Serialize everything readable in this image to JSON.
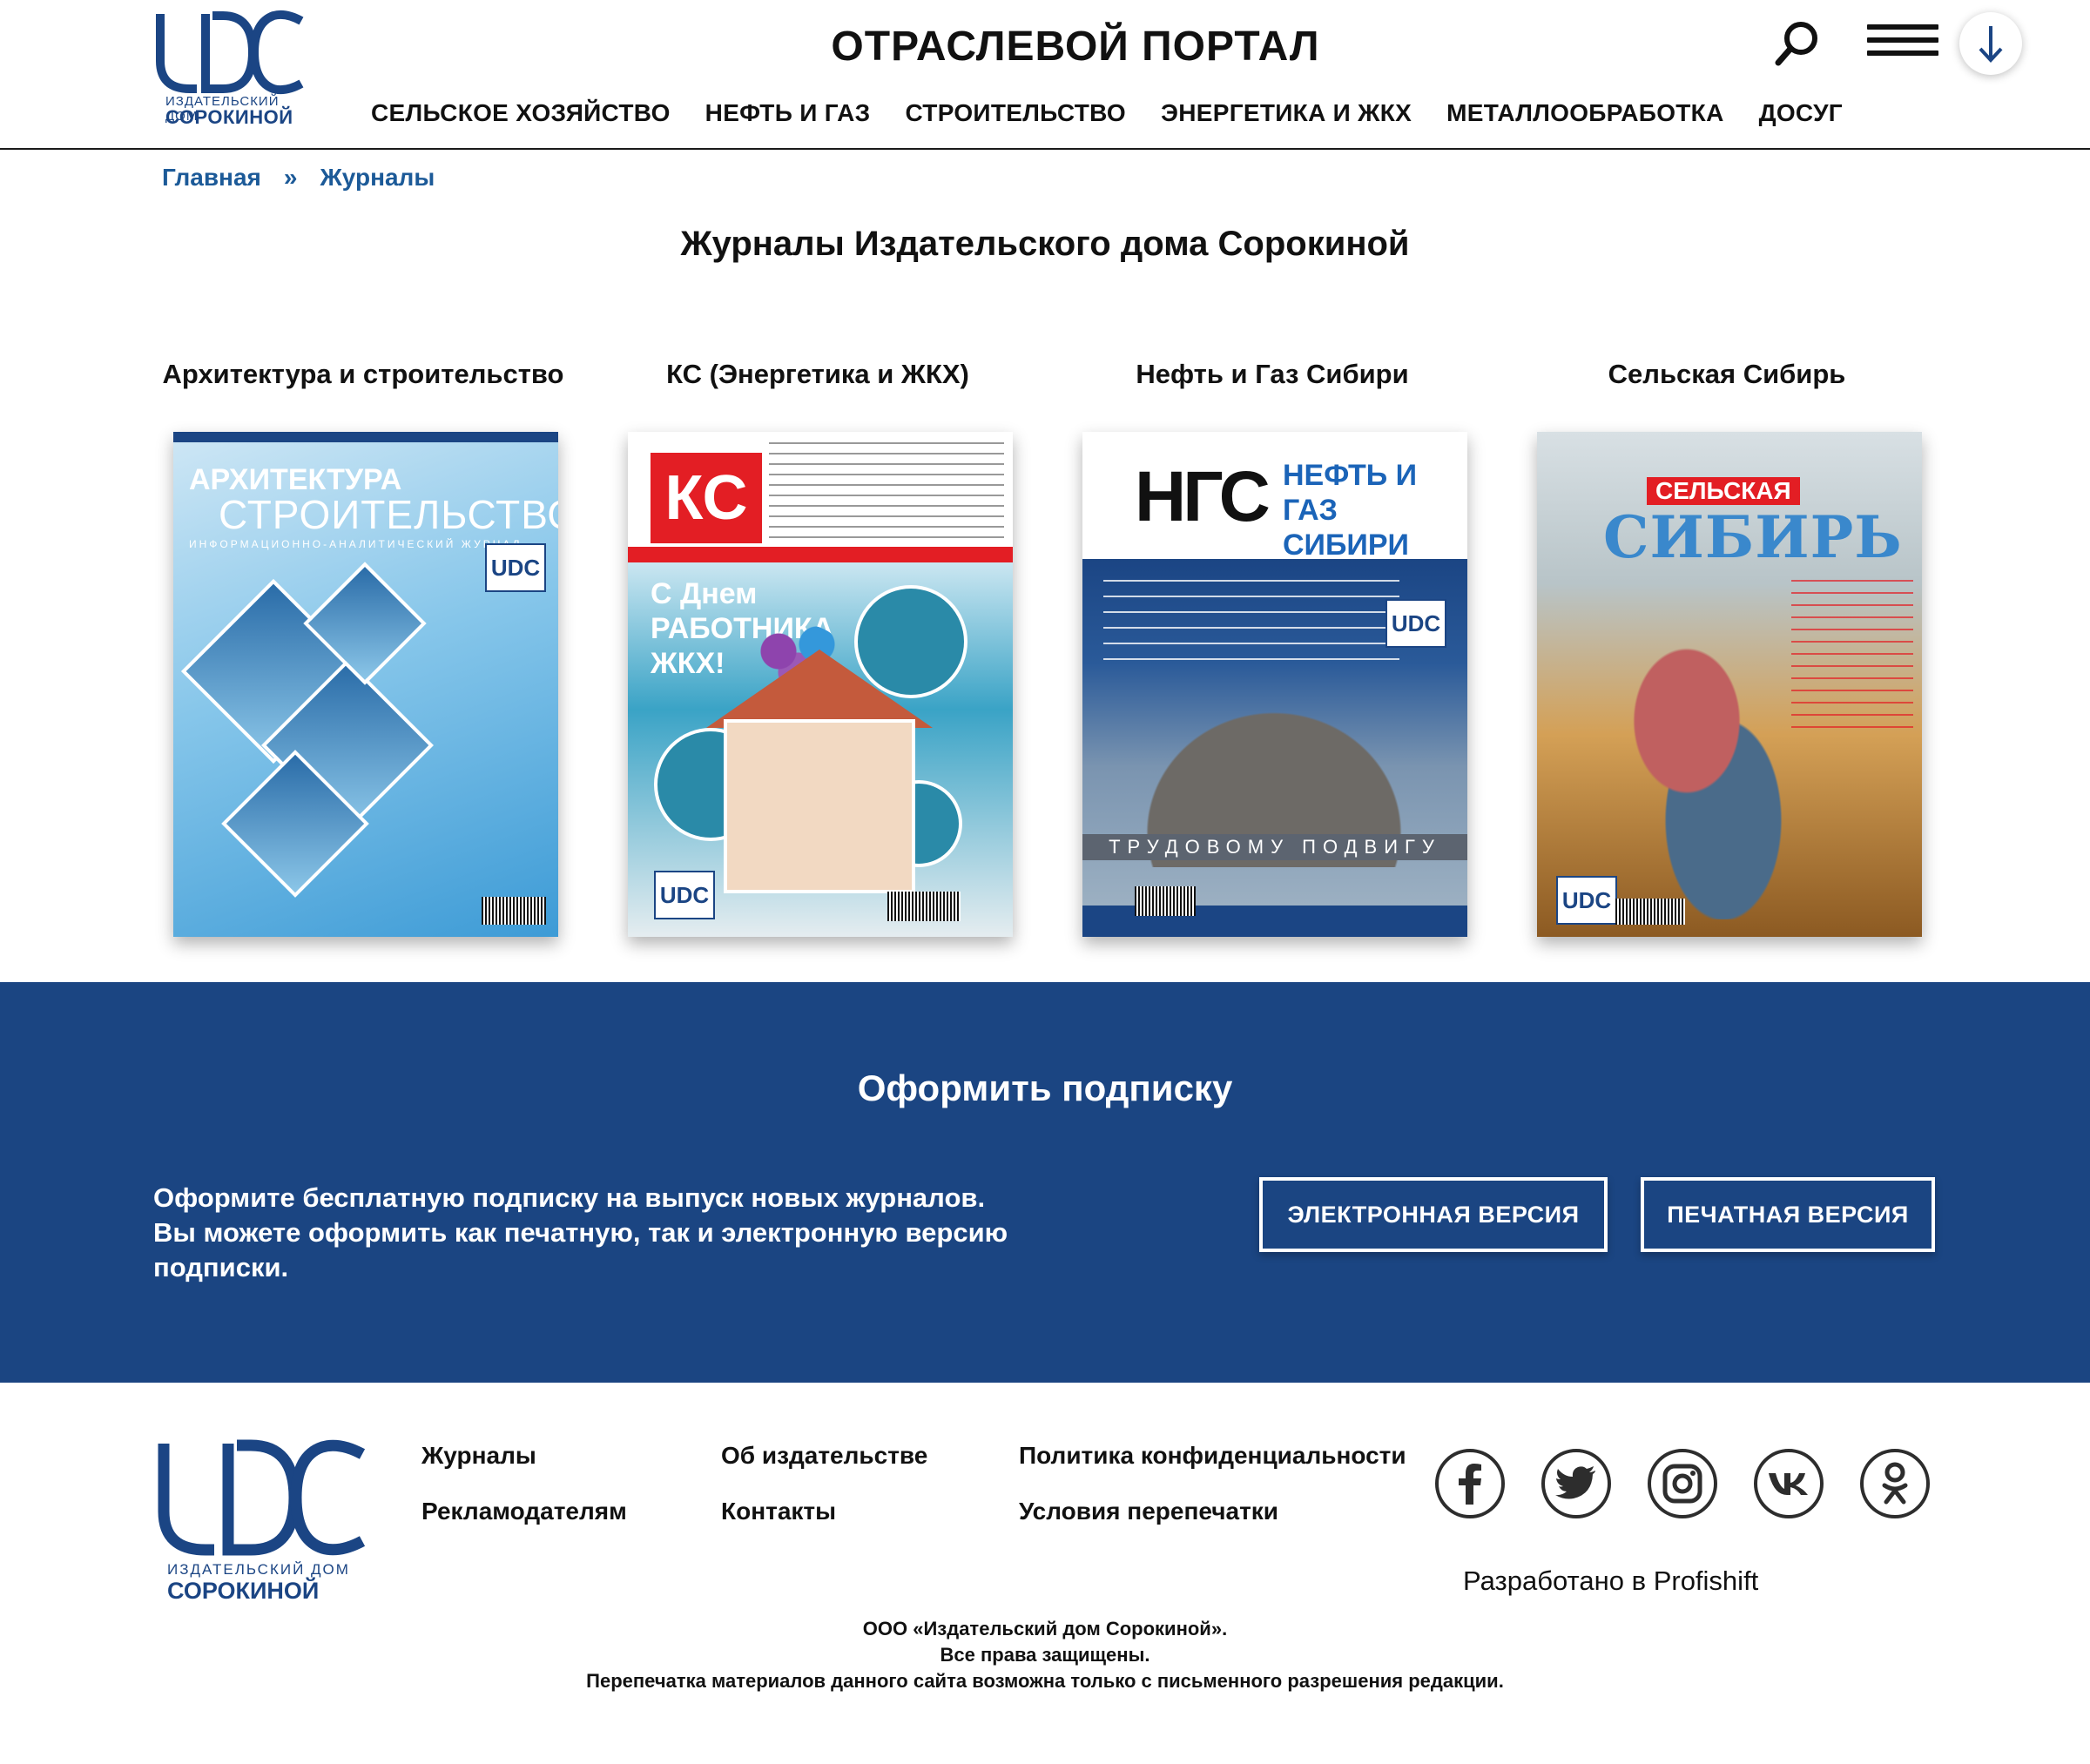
{
  "header": {
    "logo_text": "UDC",
    "logo_sub": "ИЗДАТЕЛЬСКИЙ ДОМ",
    "logo_name": "СОРОКИНОЙ",
    "portal_title": "ОТРАСЛЕВОЙ ПОРТАЛ",
    "nav": [
      "СЕЛЬСКОЕ ХОЗЯЙСТВО",
      "НЕФТЬ И ГАЗ",
      "СТРОИТЕЛЬСТВО",
      "ЭНЕРГЕТИКА И ЖКХ",
      "МЕТАЛЛООБРАБОТКА",
      "ДОСУГ"
    ],
    "icons": [
      "search-icon",
      "menu-icon",
      "arrow-down-icon"
    ]
  },
  "breadcrumb": {
    "home": "Главная",
    "separator": "»",
    "current": "Журналы"
  },
  "page_title": "Журналы Издательского дома Сорокиной",
  "magazines": [
    {
      "title": "Архитектура и строительство",
      "cover_line1": "АРХИТЕКТУРА",
      "cover_line2": "СТРОИТЕЛЬСТВО",
      "cover_line3": "ИНФОРМАЦИОННО-АНАЛИТИЧЕСКИЙ ЖУРНАЛ"
    },
    {
      "title": "КС (Энергетика и ЖКХ)",
      "cover_logo": "КС",
      "cover_line1": "С Днем",
      "cover_line2": "РАБОТНИКА",
      "cover_line3": "ЖКХ!"
    },
    {
      "title": "Нефть и Газ Сибири",
      "cover_logo": "НГС",
      "cover_line1": "НЕФТЬ И ГАЗ",
      "cover_line2": "СИБИРИ",
      "cover_line3": "ТРУДОВОМУ ПОДВИГУ"
    },
    {
      "title": "Сельская Сибирь",
      "cover_line1": "СЕЛЬСКАЯ",
      "cover_line2": "СИБИРЬ"
    }
  ],
  "subscribe": {
    "title": "Оформить подписку",
    "text": "Оформите бесплатную подписку на выпуск новых журналов. Вы можете оформить как печатную, так и электронную версию подписки.",
    "btn_electronic": "ЭЛЕКТРОННАЯ ВЕРСИЯ",
    "btn_print": "ПЕЧАТНАЯ ВЕРСИЯ",
    "bg_color": "#1b4582"
  },
  "footer": {
    "links": {
      "journals": "Журналы",
      "advertisers": "Рекламодателям",
      "about": "Об издательстве",
      "contacts": "Контакты",
      "privacy": "Политика конфиденциальности",
      "reprint": "Условия перепечатки"
    },
    "social": [
      "facebook-icon",
      "twitter-icon",
      "instagram-icon",
      "vk-icon",
      "odnoklassniki-icon"
    ],
    "developed": "Разработано в Profishift",
    "legal1": "ООО «Издательский дом Сорокиной».",
    "legal2": "Все права защищены.",
    "legal3": "Перепечатка материалов данного сайта возможна только с письменного разрешения редакции."
  },
  "colors": {
    "brand_blue": "#1b4584",
    "link_blue": "#1c5a98"
  }
}
